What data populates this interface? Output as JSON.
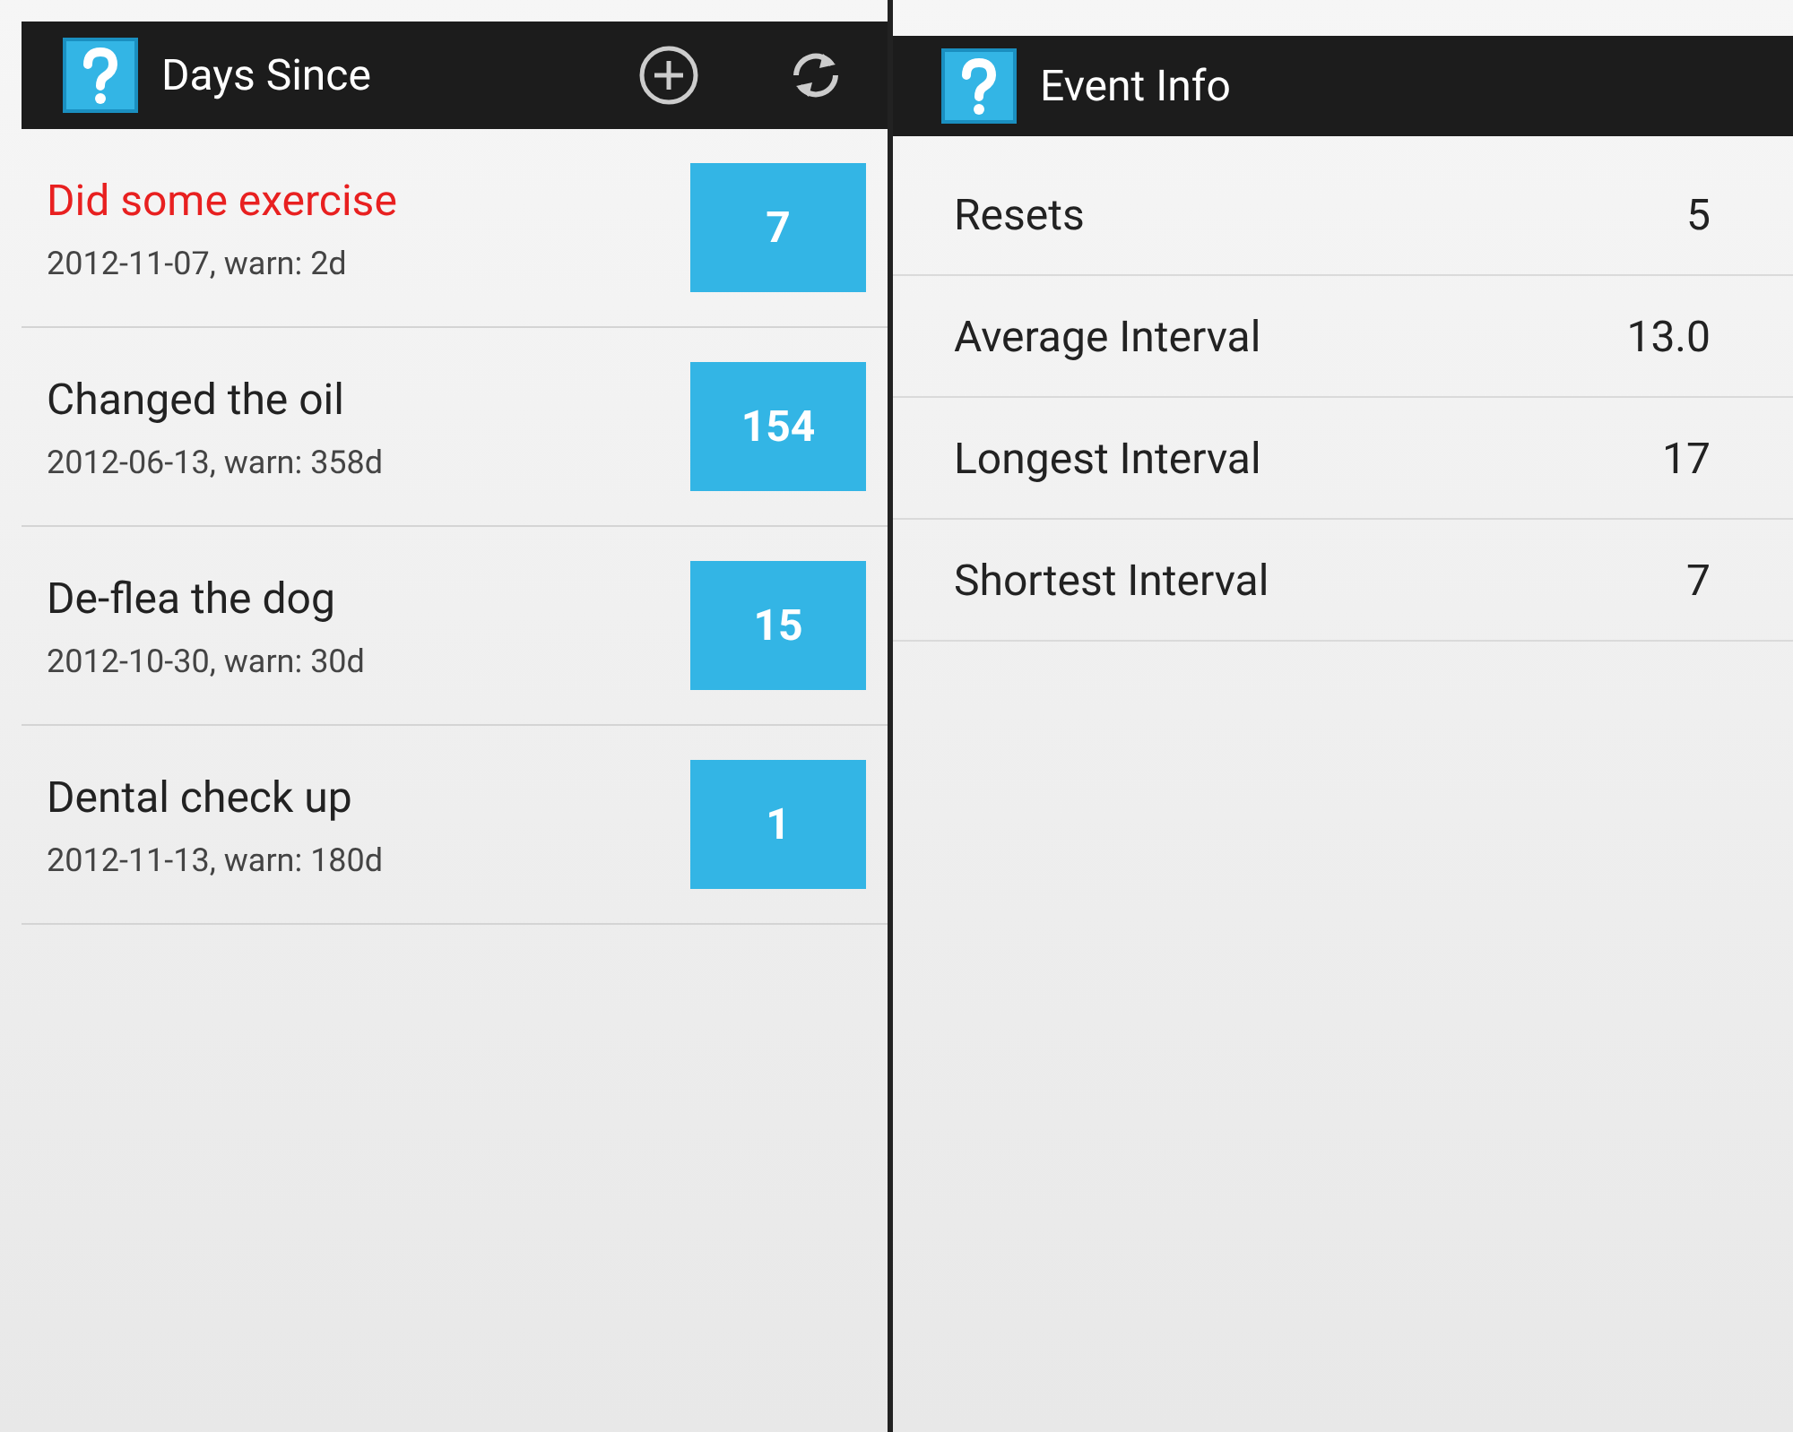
{
  "left": {
    "title": "Days Since",
    "events": [
      {
        "name": "Did some exercise",
        "detail": "2012-11-07, warn: 2d",
        "days": "7",
        "overdue": true
      },
      {
        "name": "Changed the oil",
        "detail": "2012-06-13, warn: 358d",
        "days": "154",
        "overdue": false
      },
      {
        "name": "De-flea the dog",
        "detail": "2012-10-30, warn: 30d",
        "days": "15",
        "overdue": false
      },
      {
        "name": "Dental check up",
        "detail": "2012-11-13, warn: 180d",
        "days": "1",
        "overdue": false
      }
    ]
  },
  "right": {
    "title": "Event Info",
    "stats": [
      {
        "label": "Resets",
        "value": "5"
      },
      {
        "label": "Average Interval",
        "value": "13.0"
      },
      {
        "label": "Longest Interval",
        "value": "17"
      },
      {
        "label": "Shortest Interval",
        "value": "7"
      }
    ]
  }
}
